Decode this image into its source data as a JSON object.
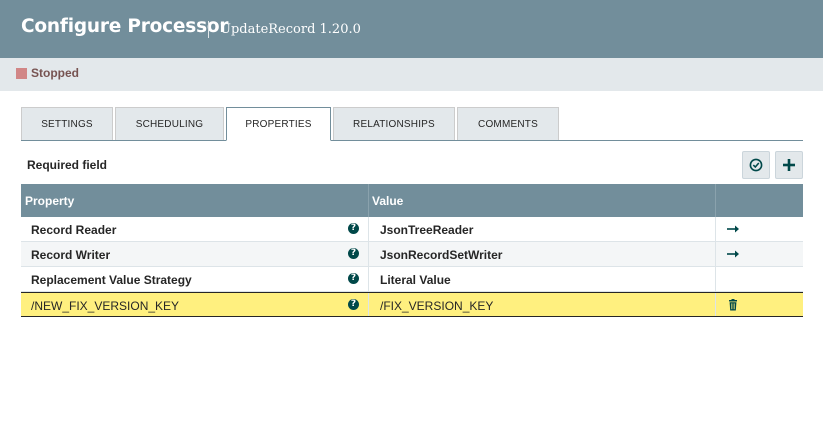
{
  "header": {
    "title": "Configure Processor",
    "subtitle": "UpdateRecord 1.20.0"
  },
  "status": {
    "text": "Stopped",
    "color": "#d18686"
  },
  "tabs": [
    {
      "label": "SETTINGS",
      "active": false
    },
    {
      "label": "SCHEDULING",
      "active": false
    },
    {
      "label": "PROPERTIES",
      "active": true
    },
    {
      "label": "RELATIONSHIPS",
      "active": false
    },
    {
      "label": "COMMENTS",
      "active": false
    }
  ],
  "toolbar": {
    "required_label": "Required field",
    "verify_icon": "check-circle-icon",
    "add_icon": "plus-icon"
  },
  "table": {
    "headers": {
      "property": "Property",
      "value": "Value"
    },
    "rows": [
      {
        "property": "Record Reader",
        "value": "JsonTreeReader",
        "action": "arrow-right-icon"
      },
      {
        "property": "Record Writer",
        "value": "JsonRecordSetWriter",
        "action": "arrow-right-icon"
      },
      {
        "property": "Replacement Value Strategy",
        "value": "Literal Value",
        "action": ""
      },
      {
        "property": "/NEW_FIX_VERSION_KEY",
        "value": "/FIX_VERSION_KEY",
        "action": "trash-icon"
      }
    ]
  },
  "colors": {
    "header_bg": "#728e9b",
    "highlight_row": "#fff07f",
    "icon_dark": "#004849"
  }
}
